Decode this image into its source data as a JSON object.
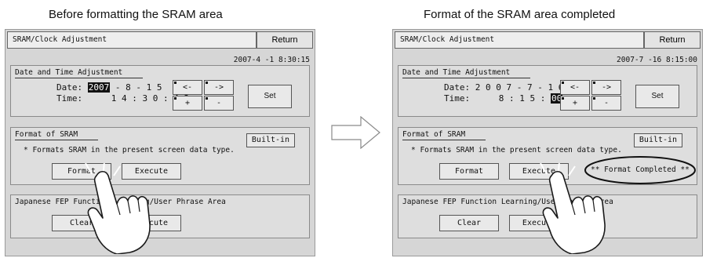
{
  "left": {
    "caption": "Before formatting the SRAM area",
    "title": "SRAM/Clock Adjustment",
    "return_label": "Return",
    "timestamp": "2007-4 -1   8:30:15",
    "datetime": {
      "heading": "Date and Time Adjustment",
      "date_label": "Date:",
      "year": "2007",
      "date_rest": "-   8 - 1 5",
      "time_label": "Time:",
      "time_value": "1 4 : 3 0 : 4 3",
      "left_arrow": "<-",
      "right_arrow": "->",
      "plus": "+",
      "minus": "-",
      "set_label": "Set"
    },
    "format": {
      "heading": "Format of SRAM",
      "builtin_label": "Built-in",
      "description": "* Formats SRAM in the present screen data type.",
      "format_label": "Format",
      "execute_label": "Execute"
    },
    "fep": {
      "heading": "Japanese FEP Function Learning/User Phrase Area",
      "clear_label": "Clear",
      "execute_label": "Execute"
    }
  },
  "right": {
    "caption": "Format of the SRAM area completed",
    "title": "SRAM/Clock Adjustment",
    "return_label": "Return",
    "timestamp": "2007-7 -16   8:15:00",
    "datetime": {
      "heading": "Date and Time Adjustment",
      "date_label": "Date:",
      "date_value": "2 0 0 7 -   7 - 1 6",
      "time_label": "Time:",
      "time_rest": "8   : 1 5 :",
      "seconds": "00",
      "left_arrow": "<-",
      "right_arrow": "->",
      "plus": "+",
      "minus": "-",
      "set_label": "Set"
    },
    "format": {
      "heading": "Format of SRAM",
      "builtin_label": "Built-in",
      "description": "* Formats SRAM in the present screen data type.",
      "format_label": "Format",
      "execute_label": "Execute",
      "completed_msg": "** Format Completed **"
    },
    "fep": {
      "heading": "Japanese FEP Function Learning/User Phrase Area",
      "clear_label": "Clear",
      "execute_label": "Execute"
    }
  }
}
